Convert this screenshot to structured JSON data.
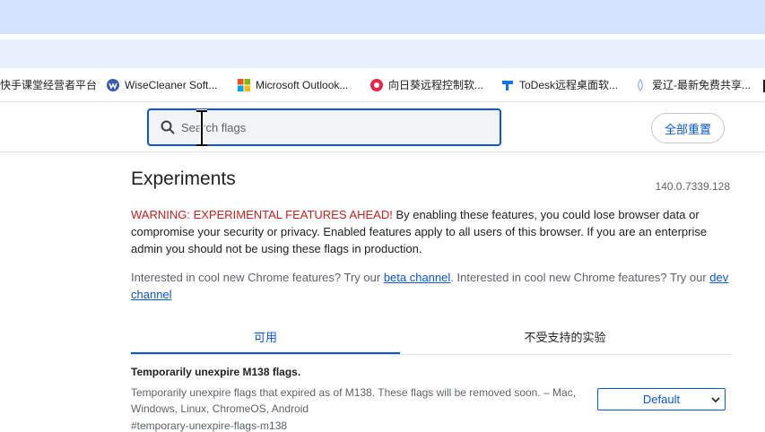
{
  "bookmarks": [
    {
      "label": "快手课堂经营者平台",
      "icon": "none"
    },
    {
      "label": "WiseCleaner Soft...",
      "icon": "wisecleaner-icon"
    },
    {
      "label": "Microsoft Outlook...",
      "icon": "microsoft-icon"
    },
    {
      "label": "向日葵远程控制软...",
      "icon": "sunlogin-icon"
    },
    {
      "label": "ToDesk远程桌面软...",
      "icon": "todesk-icon"
    },
    {
      "label": "爱辽-最新免费共享...",
      "icon": "aiiao-icon"
    }
  ],
  "search": {
    "placeholder": "Search flags",
    "value": ""
  },
  "reset_label": "全部重置",
  "page": {
    "title": "Experiments",
    "version": "140.0.7339.128",
    "warning_prefix": "WARNING: EXPERIMENTAL FEATURES AHEAD!",
    "warning_body": " By enabling these features, you could lose browser data or compromise your security or privacy. Enabled features apply to all users of this browser. If you are an enterprise admin you should not be using these flags in production.",
    "interest_1": "Interested in cool new Chrome features? Try our ",
    "beta_link": "beta channel",
    "interest_2": ". Interested in cool new Chrome features? Try our ",
    "dev_link": "dev channel"
  },
  "tabs": [
    {
      "label": "可用",
      "active": true
    },
    {
      "label": "不受支持的实验",
      "active": false
    }
  ],
  "flag": {
    "name": "Temporarily unexpire M138 flags.",
    "description": "Temporarily unexpire flags that expired as of M138. These flags will be removed soon. – Mac, Windows, Linux, ChromeOS, Android",
    "hash": "#temporary-unexpire-flags-m138",
    "selected": "Default"
  },
  "colors": {
    "accent": "#0b57d0",
    "warning": "#c5221f",
    "tab_strip": "#d3e3fd"
  }
}
